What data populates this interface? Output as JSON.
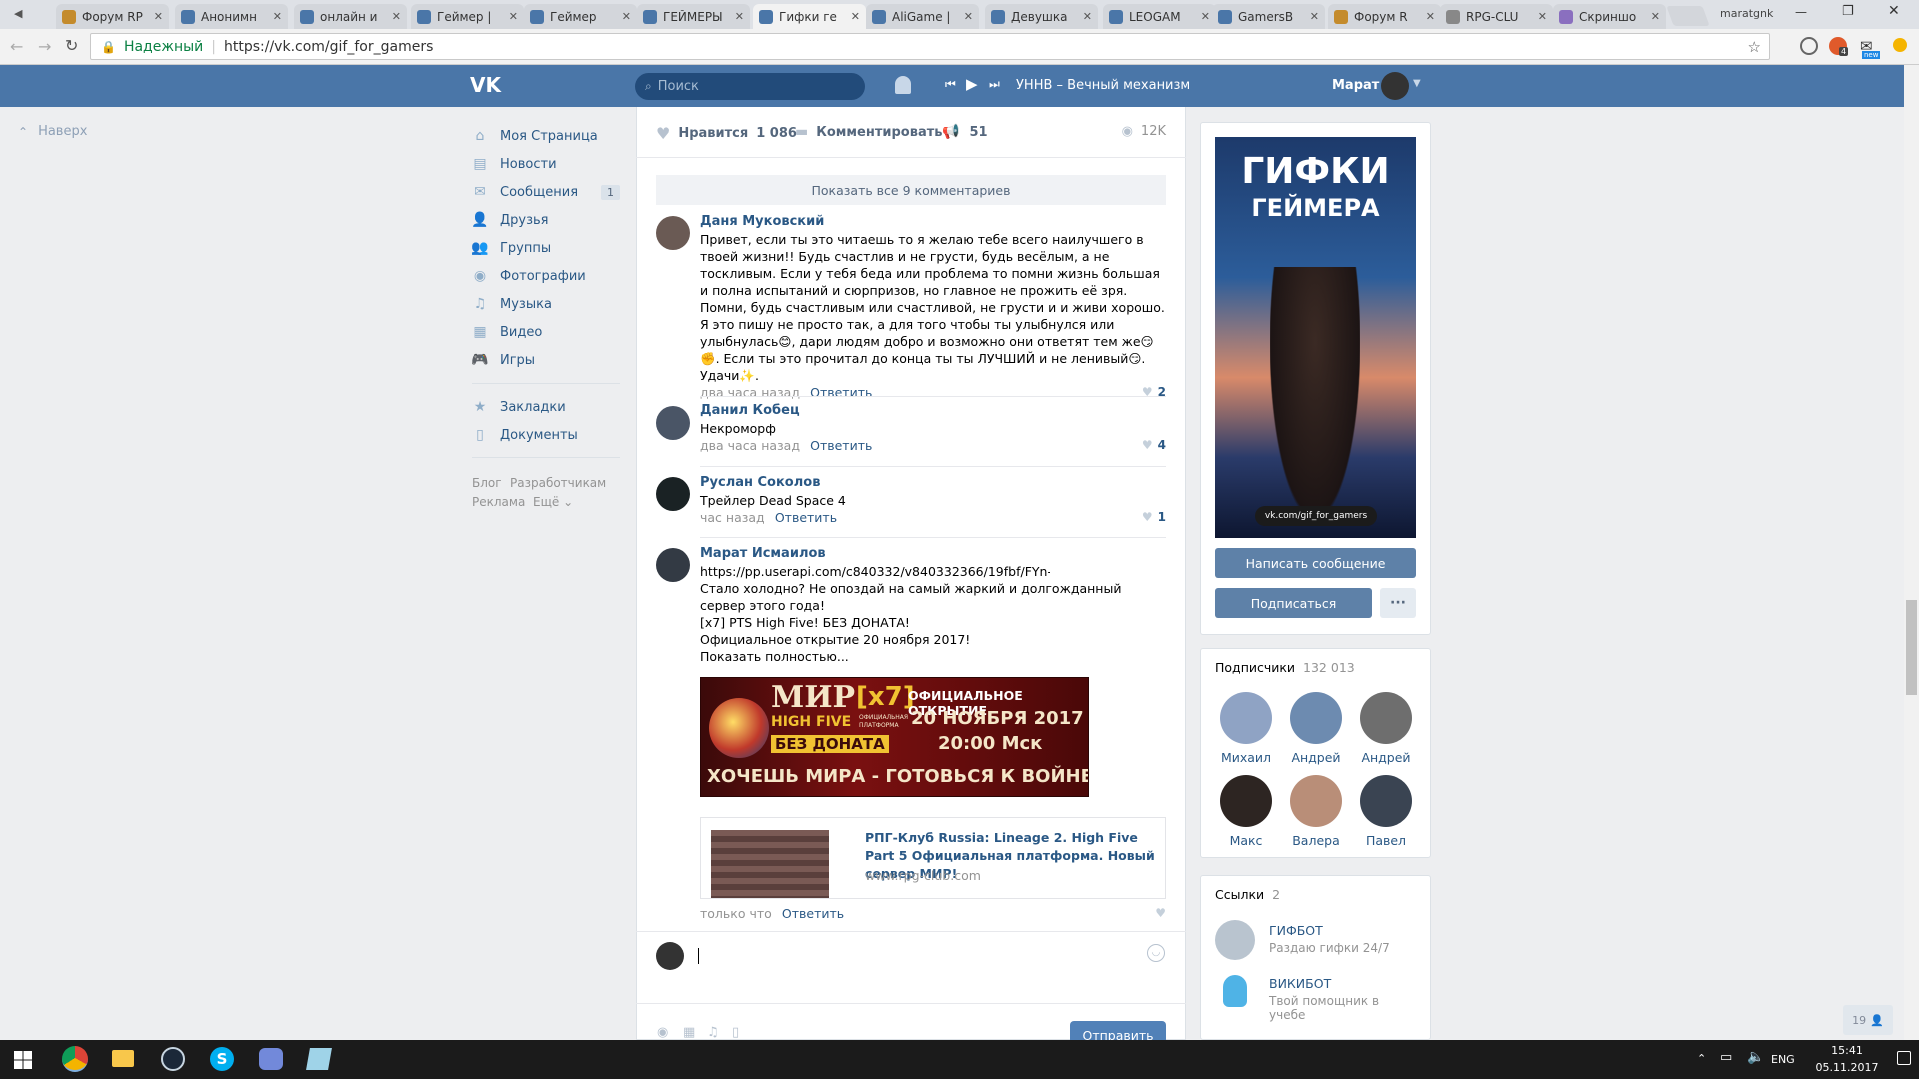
{
  "browser": {
    "tabs": [
      {
        "title": "Форум RP",
        "close": "✕"
      },
      {
        "title": "Анонимн",
        "close": "✕"
      },
      {
        "title": "онлайн и",
        "close": "✕"
      },
      {
        "title": "Геймер |",
        "close": "✕"
      },
      {
        "title": "Геймер",
        "close": "✕"
      },
      {
        "title": "ГЕЙМЕРЫ",
        "close": "✕"
      },
      {
        "title": "Гифки ге",
        "close": "✕"
      },
      {
        "title": "AliGame |",
        "close": "✕"
      },
      {
        "title": "Девушка",
        "close": "✕"
      },
      {
        "title": "LEOGAM",
        "close": "✕"
      },
      {
        "title": "GamersB",
        "close": "✕"
      },
      {
        "title": "Форум R",
        "close": "✕"
      },
      {
        "title": "RPG-CLU",
        "close": "✕"
      },
      {
        "title": "Скриншо",
        "close": "✕"
      }
    ],
    "profile_name": "maratgnk",
    "secure_label": "Надежный",
    "url": "https://vk.com/gif_for_gamers",
    "ext_badge": "4",
    "ext_new": "new"
  },
  "header": {
    "logo": "VK",
    "search_placeholder": "Поиск",
    "track": "УННВ – Вечный механизм",
    "user_name": "Марат"
  },
  "left": {
    "top_link": "Наверх"
  },
  "nav": {
    "items": [
      {
        "label": "Моя Страница",
        "icon": "home-icon"
      },
      {
        "label": "Новости",
        "icon": "news-icon"
      },
      {
        "label": "Сообщения",
        "icon": "messages-icon",
        "badge": "1"
      },
      {
        "label": "Друзья",
        "icon": "friends-icon"
      },
      {
        "label": "Группы",
        "icon": "groups-icon"
      },
      {
        "label": "Фотографии",
        "icon": "camera-icon"
      },
      {
        "label": "Музыка",
        "icon": "music-icon"
      },
      {
        "label": "Видео",
        "icon": "video-icon"
      },
      {
        "label": "Игры",
        "icon": "gamepad-icon"
      }
    ],
    "items2": [
      {
        "label": "Закладки",
        "icon": "star-icon"
      },
      {
        "label": "Документы",
        "icon": "document-icon"
      }
    ],
    "footer": {
      "blog": "Блог",
      "dev": "Разработчикам",
      "ads": "Реклама",
      "more": "Ещё ⌄"
    }
  },
  "post": {
    "like_label": "Нравится",
    "like_count": "1 086",
    "comment_label": "Комментировать",
    "share_count": "51",
    "views": "12K",
    "show_all": "Показать все 9 комментариев",
    "comments": [
      {
        "name": "Даня Муковский",
        "text": "Привет, если ты это читаешь то я желаю тебе всего наилучшего в твоей жизни!! Будь счастлив и не грусти, будь весёлым, а не тоскливым. Если у тебя беда или проблема то помни жизнь большая и полна испытаний и сюрпризов, но главное не прожить её зря. Помни, будь счастливым или счастливой, не грусти и и живи хорошо. Я это пишу не просто так, а для того чтобы ты улыбнулся или улыбнулась😊, дари людям добро и возможно они ответят тем же😏✊. Если ты это прочитал до конца ты ты ЛУЧШИЙ и не ленивый😏. Удачи✨.",
        "time": "два часа назад",
        "reply": "Ответить",
        "likes": "2"
      },
      {
        "name": "Данил Кобец",
        "text": "Некроморф",
        "time": "два часа назад",
        "reply": "Ответить",
        "likes": "4"
      },
      {
        "name": "Руслан Соколов",
        "text": "Трейлер Dead Space 4",
        "time": "час назад",
        "reply": "Ответить",
        "likes": "1"
      },
      {
        "name": "Марат Исмаилов",
        "link": "https://pp.userapi.com/c840332/v840332366/19fbf/FYn-...",
        "lines": [
          "Стало холодно? Не опоздай на самый жаркий и долгожданный сервер этого года!",
          "[x7] PTS High Five! БЕЗ ДОНАТА!",
          "Официальное открытие 20 ноября 2017!"
        ],
        "show_more": "Показать полностью...",
        "time": "только что",
        "reply": "Ответить"
      }
    ],
    "banner": {
      "mir": "МИР",
      "x7": "[x7]",
      "official": "ОФИЦИАЛЬНОЕ ОТКРЫТИЕ",
      "high_five": "HIGH FIVE",
      "platform": "ОФИЦИАЛЬНАЯ ПЛАТФОРМА",
      "date": "20 НОЯБРЯ 2017",
      "no_donate": "БЕЗ ДОНАТА",
      "time": "20:00 Мск",
      "slogan": "ХОЧЕШЬ МИРА - ГОТОВЬСЯ К ВОЙНЕ"
    },
    "snippet": {
      "title": "РПГ-Клуб Russia: Lineage 2. High Five Part 5 Официальная платформа. Новый сервер МИР!",
      "domain": "www.rpg-club.com"
    },
    "send_label": "Отправить"
  },
  "group": {
    "cover_title_1": "ГИФКИ",
    "cover_title_2": "ГЕЙМЕРА",
    "cover_url": "vk.com/gif_for_gamers",
    "message_btn": "Написать сообщение",
    "subscribe_btn": "Подписаться",
    "more_btn": "···",
    "subscribers_label": "Подписчики",
    "subscribers_count": "132 013",
    "friends": [
      "Михаил",
      "Андрей",
      "Андрей",
      "Макс",
      "Валера",
      "Павел"
    ],
    "links_label": "Ссылки",
    "links_count": "2",
    "links": [
      {
        "name": "ГИФБОТ",
        "desc": "Раздаю гифки 24/7"
      },
      {
        "name": "ВИКИБОТ",
        "desc": "Твой помощник в учебе"
      }
    ],
    "online_count": "19"
  },
  "taskbar": {
    "lang": "ENG",
    "time": "15:41",
    "date": "05.11.2017"
  }
}
